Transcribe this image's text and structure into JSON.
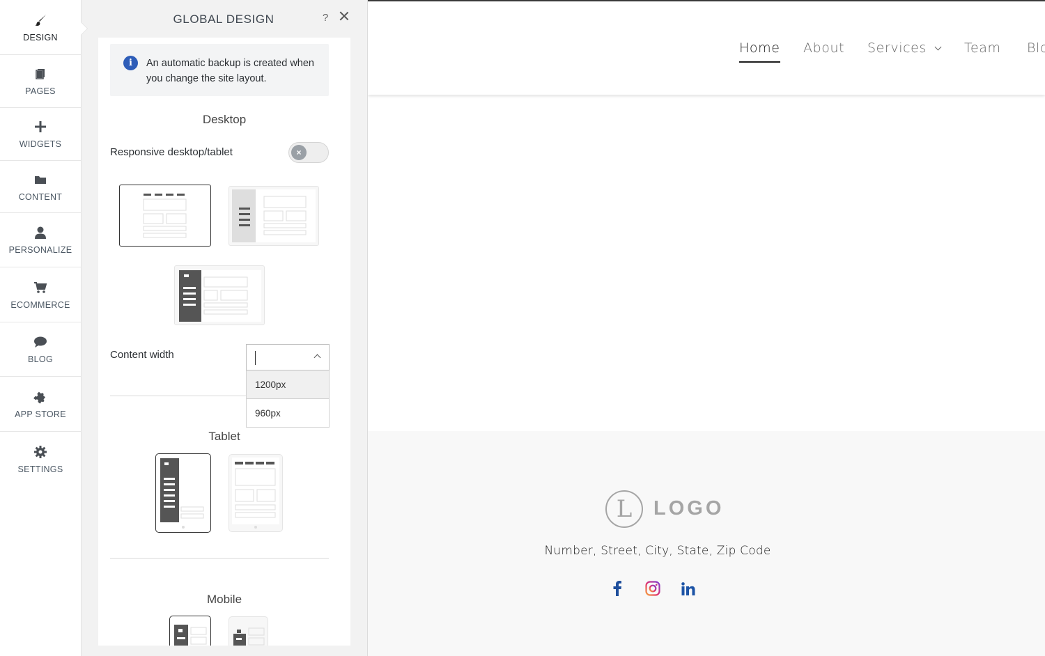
{
  "sidebar": {
    "items": [
      {
        "label": "DESIGN",
        "icon": "paintbrush-icon"
      },
      {
        "label": "PAGES",
        "icon": "pages-icon"
      },
      {
        "label": "WIDGETS",
        "icon": "plus-icon"
      },
      {
        "label": "CONTENT",
        "icon": "folder-icon"
      },
      {
        "label": "PERSONALIZE",
        "icon": "person-icon"
      },
      {
        "label": "ECOMMERCE",
        "icon": "cart-icon"
      },
      {
        "label": "BLOG",
        "icon": "speech-bubble-icon"
      },
      {
        "label": "APP STORE",
        "icon": "puzzle-icon"
      },
      {
        "label": "SETTINGS",
        "icon": "gear-icon"
      }
    ]
  },
  "panel": {
    "title": "GLOBAL DESIGN",
    "help": "?",
    "info": "An automatic backup is created when you change the site layout.",
    "desktop": {
      "title": "Desktop",
      "responsive_label": "Responsive desktop/tablet",
      "responsive_on": false
    },
    "content_width": {
      "label": "Content width",
      "value": "",
      "options": [
        "1200px",
        "960px"
      ]
    },
    "tablet": {
      "title": "Tablet"
    },
    "mobile": {
      "title": "Mobile"
    }
  },
  "site": {
    "nav": [
      {
        "label": "Home",
        "active": true
      },
      {
        "label": "About"
      },
      {
        "label": "Services",
        "has_dropdown": true
      },
      {
        "label": "Team"
      },
      {
        "label": "Blo"
      }
    ],
    "footer": {
      "logo_letter": "L",
      "logo_text": "LOGO",
      "address": "Number, Street, City, State, Zip Code",
      "social": [
        "facebook-icon",
        "instagram-icon",
        "linkedin-icon"
      ]
    }
  },
  "colors": {
    "accent_blue": "#2e5db8",
    "facebook": "#1e4e9c",
    "linkedin": "#1d54a6"
  }
}
